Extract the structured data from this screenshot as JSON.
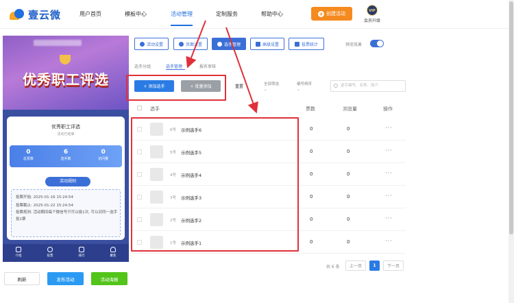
{
  "app": {
    "logo_text": "壹云微"
  },
  "nav": {
    "items": [
      "用户首页",
      "模板中心",
      "活动管理",
      "定制服务",
      "帮助中心"
    ],
    "create_label": "创建活动",
    "vip_badge": "VIP",
    "vip_label": "会员升级"
  },
  "preview": {
    "banner_title": "优秀职工评选",
    "card_title": "优秀职工评选",
    "card_status": "活动已结束",
    "stats": [
      {
        "value": "0",
        "label": "总票数"
      },
      {
        "value": "6",
        "label": "选手数"
      },
      {
        "value": "0",
        "label": "访问量"
      }
    ],
    "rules_button": "活动规则",
    "vote_start": "投票开始: 2025-01-16 15:24:54",
    "vote_end": "投票截止: 2025-01-22 15:24:54",
    "vote_rule": "投票规则: 活动期间每个微信号只可以投1次, 可以对同一选手投1票",
    "tabs": [
      "介绍",
      "投票",
      "排行",
      "聚焦"
    ]
  },
  "actions": {
    "refresh": "刷新",
    "publish": "发布活动",
    "poster": "活动海报"
  },
  "toolbar": {
    "buttons": [
      "活动设置",
      "页面设置",
      "选手管理",
      "高级设置",
      "投票统计"
    ],
    "preview_label": "预览效果",
    "preview_on": true
  },
  "subtabs": [
    "选手分组",
    "选手管理",
    "报名审核"
  ],
  "controls": {
    "add_single": "+ 添加选手",
    "add_batch": "+ 批量添加",
    "reset": "重置",
    "filter_all": "全部筛选",
    "filter_sort": "编号倒序",
    "search_placeholder": "选手编号、名称、简介"
  },
  "table": {
    "headers": [
      "选手",
      "票数",
      "浏览量",
      "操作"
    ],
    "rows": [
      {
        "num": "6号",
        "name": "示例选手6",
        "votes": "0",
        "views": "0",
        "ops": "···"
      },
      {
        "num": "5号",
        "name": "示例选手5",
        "votes": "0",
        "views": "0",
        "ops": "···"
      },
      {
        "num": "4号",
        "name": "示例选手4",
        "votes": "0",
        "views": "0",
        "ops": "···"
      },
      {
        "num": "3号",
        "name": "示例选手3",
        "votes": "0",
        "views": "0",
        "ops": "···"
      },
      {
        "num": "2号",
        "name": "示例选手2",
        "votes": "0",
        "views": "0",
        "ops": "···"
      },
      {
        "num": "1号",
        "name": "示例选手1",
        "votes": "0",
        "views": "0",
        "ops": "···"
      }
    ]
  },
  "pagination": {
    "total": "共 6 条",
    "prev": "上一页",
    "current": "1",
    "next": "下一页"
  },
  "colors": {
    "accent": "#3b6fd8",
    "highlight": "#e0303a",
    "create_button": "#f58a1f"
  }
}
